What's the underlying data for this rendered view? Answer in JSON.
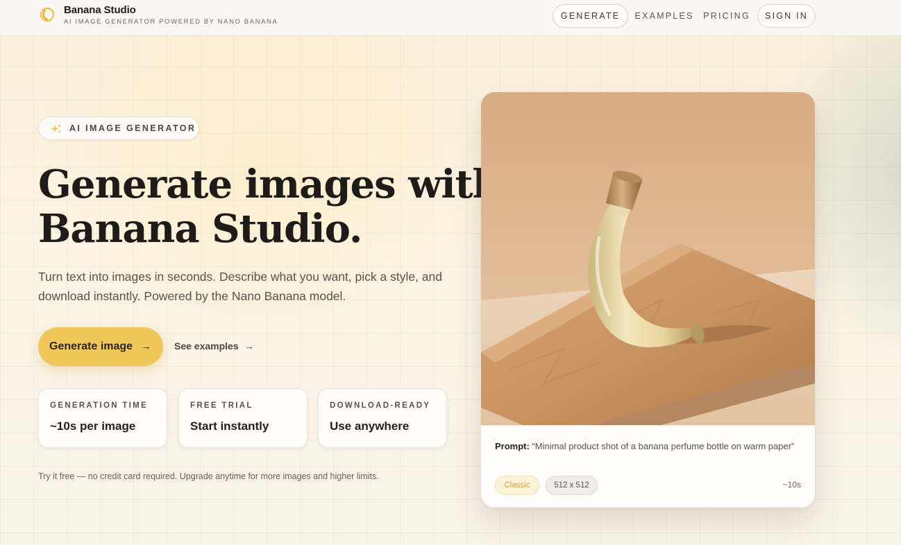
{
  "brand": {
    "name": "Banana Studio",
    "tagline": "AI IMAGE GENERATOR POWERED BY NANO BANANA"
  },
  "nav": {
    "generate": "GENERATE",
    "examples": "EXAMPLES",
    "pricing": "PRICING",
    "sign_in": "SIGN IN"
  },
  "hero": {
    "badge": "AI IMAGE GENERATOR",
    "title_line1": "Generate images with",
    "title_line2": "Banana Studio.",
    "subtitle": "Turn text into images in seconds. Describe what you want, pick a style, and download instantly. Powered by the Nano Banana model.",
    "primary_cta": "Generate image",
    "secondary_cta": "See examples",
    "footnote": "Try it free — no credit card required. Upgrade anytime for more images and higher limits."
  },
  "stats": [
    {
      "label": "GENERATION TIME",
      "value": "~10s per image"
    },
    {
      "label": "FREE TRIAL",
      "value": "Start instantly"
    },
    {
      "label": "DOWNLOAD-READY",
      "value": "Use anywhere"
    }
  ],
  "preview": {
    "prompt_label": "Prompt:",
    "prompt_text": "“Minimal product shot of a banana perfume bottle on warm paper”",
    "style_chip": "Classic",
    "size_chip": "512 x 512",
    "time": "~10s",
    "image_alt": "banana-shaped perfume bottle on crumpled kraft paper"
  },
  "icons": {
    "logo": "banana-logo-icon",
    "badge": "sparkles-icon",
    "arrow": "arrow-right-icon"
  },
  "colors": {
    "accent": "#f2c75a",
    "accent_text": "#d7a33a",
    "background": "#f9f3e7"
  }
}
